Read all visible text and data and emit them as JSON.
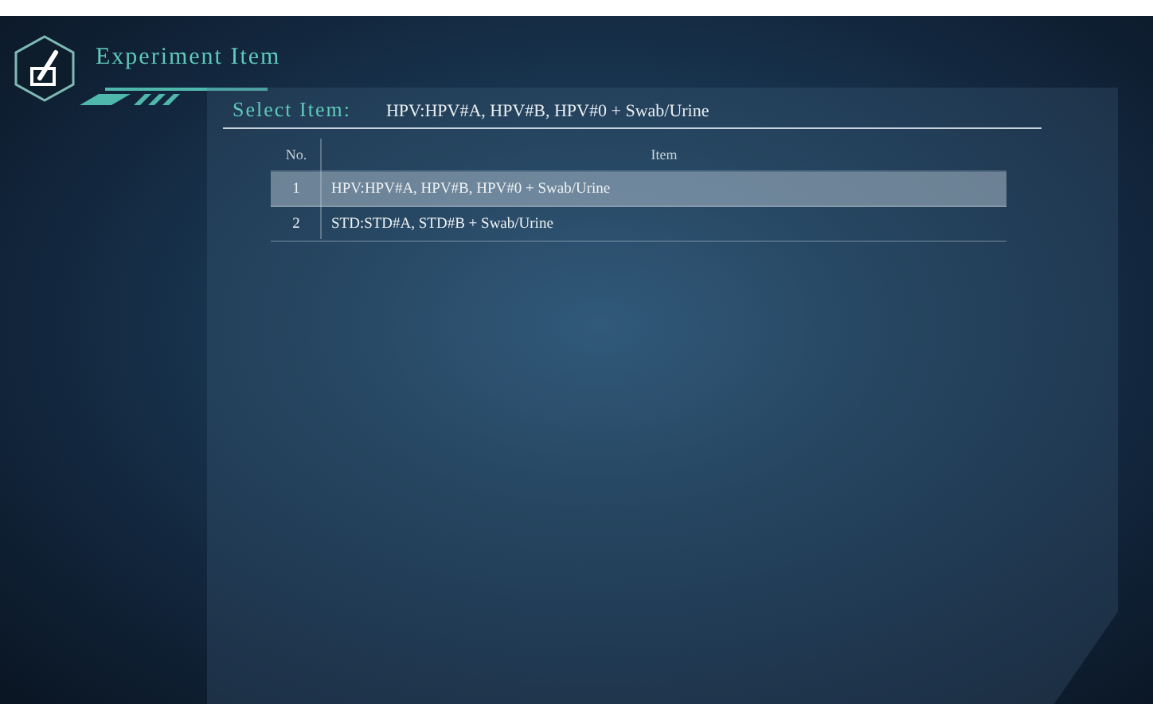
{
  "header": {
    "title": "Experiment Item"
  },
  "selection": {
    "label": "Select Item:",
    "value": "HPV:HPV#A, HPV#B, HPV#0 + Swab/Urine"
  },
  "table": {
    "columns": [
      "No.",
      "Item"
    ],
    "rows": [
      {
        "no": "1",
        "item": "HPV:HPV#A, HPV#B, HPV#0 + Swab/Urine",
        "selected": true
      },
      {
        "no": "2",
        "item": "STD:STD#A, STD#B + Swab/Urine",
        "selected": false
      }
    ]
  }
}
